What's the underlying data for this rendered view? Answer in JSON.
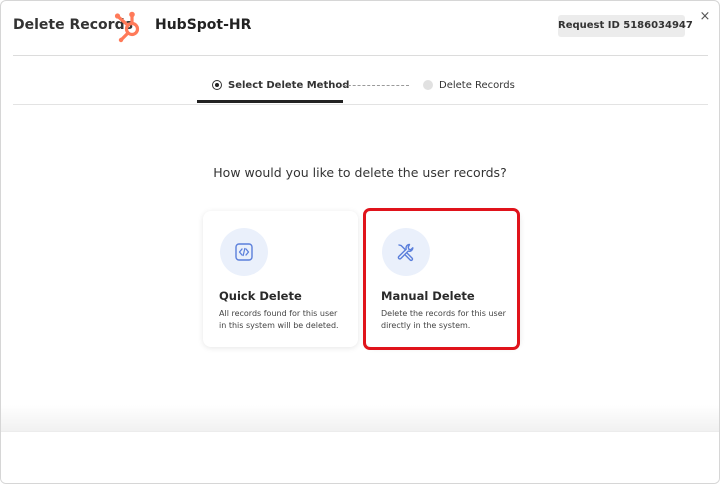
{
  "header": {
    "title": "Delete Records",
    "app_name": "HubSpot-HR",
    "request_id": "Request ID 5186034947",
    "close_label": "×"
  },
  "stepper": {
    "steps": [
      {
        "label": "Select Delete Method",
        "state": "active"
      },
      {
        "label": "Delete Records",
        "state": "inactive"
      }
    ]
  },
  "question": "How would you like to delete the user records?",
  "cards": [
    {
      "title": "Quick Delete",
      "description": "All records found for this user in this system will be deleted.",
      "icon": "code-icon"
    },
    {
      "title": "Manual Delete",
      "description": "Delete the records for this user directly in the system.",
      "icon": "tools-icon",
      "highlighted": true
    }
  ],
  "colors": {
    "brand": "#ff7a59",
    "highlight": "#e0131b",
    "icon_accent": "#5b7fdb",
    "icon_bg": "#eaf0fb"
  }
}
